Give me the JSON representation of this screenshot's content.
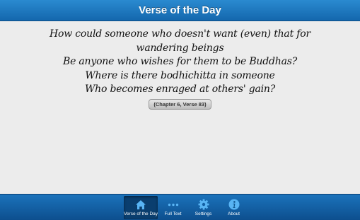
{
  "header": {
    "title": "Verse of the Day"
  },
  "verse": {
    "lines": [
      "How could someone who doesn't want (even) that for",
      "wandering beings",
      "Be anyone who wishes for them to be Buddhas?",
      "Where is there bodhichitta in someone",
      "Who becomes enraged at others' gain?"
    ],
    "reference": "(Chapter 6, Verse 83)"
  },
  "tabbar": {
    "tabs": [
      {
        "label": "Verse of the Day",
        "icon": "home-icon",
        "active": true
      },
      {
        "label": "Full Text",
        "icon": "more-dots-icon",
        "active": false
      },
      {
        "label": "Settings",
        "icon": "gear-icon",
        "active": false
      },
      {
        "label": "About",
        "icon": "info-icon",
        "active": false
      }
    ]
  },
  "colors": {
    "header_bg": "#1b78c2",
    "tabbar_bg": "#125fa3",
    "content_bg": "#ececec",
    "icon_color": "#58b4f4"
  }
}
